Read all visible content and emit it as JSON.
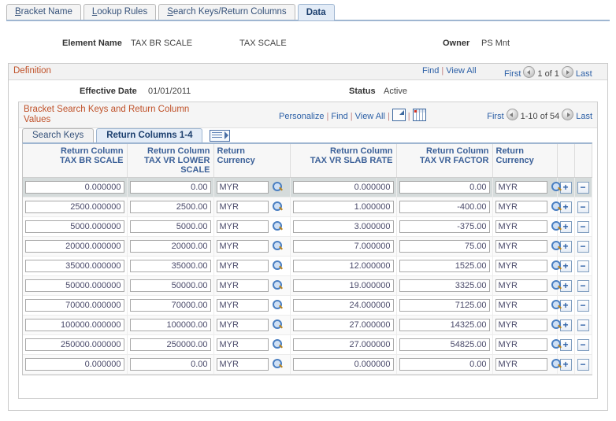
{
  "tabs": [
    {
      "label": "Bracket Name",
      "accel": "B",
      "active": false
    },
    {
      "label": "Lookup Rules",
      "accel": "L",
      "active": false
    },
    {
      "label": "Search Keys/Return Columns",
      "accel": "S",
      "active": false
    },
    {
      "label": "Data",
      "accel": "",
      "active": true
    }
  ],
  "header": {
    "element_name_label": "Element Name",
    "element_name_value": "TAX BR SCALE",
    "element_description": "TAX SCALE",
    "owner_label": "Owner",
    "owner_value": "PS Mnt"
  },
  "definition": {
    "title": "Definition",
    "find_label": "Find",
    "view_all_label": "View All",
    "first_label": "First",
    "position_label": "1 of 1",
    "last_label": "Last",
    "effective_date_label": "Effective Date",
    "effective_date_value": "01/01/2011",
    "status_label": "Status",
    "status_value": "Active"
  },
  "grid": {
    "title": "Bracket Search Keys and Return Column Values",
    "personalize_label": "Personalize",
    "find_label": "Find",
    "view_all_label": "View All",
    "newwindow_icon": "new-window-icon",
    "downloadgrid_icon": "download-grid-icon",
    "first_label": "First",
    "position_label": "1-10 of 54",
    "last_label": "Last",
    "subtabs": [
      {
        "label": "Search Keys",
        "accel": "S",
        "active": false
      },
      {
        "label": "Return Columns 1-4",
        "accel": "",
        "active": true
      }
    ],
    "expand_columns_icon": "expand-columns-icon",
    "columns": [
      {
        "line1": "Return Column",
        "line2": "TAX BR SCALE",
        "align": "right"
      },
      {
        "line1": "Return Column",
        "line2": "TAX VR LOWER SCALE",
        "align": "right"
      },
      {
        "line1": "Return",
        "line2": "Currency",
        "align": "left"
      },
      {
        "line1": "Return Column",
        "line2": "TAX VR SLAB RATE",
        "align": "right"
      },
      {
        "line1": "Return Column",
        "line2": "TAX VR FACTOR",
        "align": "right"
      },
      {
        "line1": "Return Currency",
        "line2": "",
        "align": "left"
      }
    ],
    "add_button_label": "+",
    "delete_button_label": "−",
    "search_icon": "lookup-search-icon",
    "rows": [
      {
        "selected": true,
        "tax_br_scale": "0.000000",
        "tax_vr_lower_scale": "0.00",
        "currency1": "MYR",
        "tax_vr_slab_rate": "0.000000",
        "tax_vr_factor": "0.00",
        "currency2": "MYR"
      },
      {
        "selected": false,
        "tax_br_scale": "2500.000000",
        "tax_vr_lower_scale": "2500.00",
        "currency1": "MYR",
        "tax_vr_slab_rate": "1.000000",
        "tax_vr_factor": "-400.00",
        "currency2": "MYR"
      },
      {
        "selected": false,
        "tax_br_scale": "5000.000000",
        "tax_vr_lower_scale": "5000.00",
        "currency1": "MYR",
        "tax_vr_slab_rate": "3.000000",
        "tax_vr_factor": "-375.00",
        "currency2": "MYR"
      },
      {
        "selected": false,
        "tax_br_scale": "20000.000000",
        "tax_vr_lower_scale": "20000.00",
        "currency1": "MYR",
        "tax_vr_slab_rate": "7.000000",
        "tax_vr_factor": "75.00",
        "currency2": "MYR"
      },
      {
        "selected": false,
        "tax_br_scale": "35000.000000",
        "tax_vr_lower_scale": "35000.00",
        "currency1": "MYR",
        "tax_vr_slab_rate": "12.000000",
        "tax_vr_factor": "1525.00",
        "currency2": "MYR"
      },
      {
        "selected": false,
        "tax_br_scale": "50000.000000",
        "tax_vr_lower_scale": "50000.00",
        "currency1": "MYR",
        "tax_vr_slab_rate": "19.000000",
        "tax_vr_factor": "3325.00",
        "currency2": "MYR"
      },
      {
        "selected": false,
        "tax_br_scale": "70000.000000",
        "tax_vr_lower_scale": "70000.00",
        "currency1": "MYR",
        "tax_vr_slab_rate": "24.000000",
        "tax_vr_factor": "7125.00",
        "currency2": "MYR"
      },
      {
        "selected": false,
        "tax_br_scale": "100000.000000",
        "tax_vr_lower_scale": "100000.00",
        "currency1": "MYR",
        "tax_vr_slab_rate": "27.000000",
        "tax_vr_factor": "14325.00",
        "currency2": "MYR"
      },
      {
        "selected": false,
        "tax_br_scale": "250000.000000",
        "tax_vr_lower_scale": "250000.00",
        "currency1": "MYR",
        "tax_vr_slab_rate": "27.000000",
        "tax_vr_factor": "54825.00",
        "currency2": "MYR"
      },
      {
        "selected": false,
        "tax_br_scale": "0.000000",
        "tax_vr_lower_scale": "0.00",
        "currency1": "MYR",
        "tax_vr_slab_rate": "0.000000",
        "tax_vr_factor": "0.00",
        "currency2": "MYR"
      }
    ]
  },
  "colors": {
    "group_label": "#c0522a",
    "link": "#2b5fa6",
    "column_header": "#3b6098",
    "tab_active_bg": "#e3ecf7",
    "selected_row_bg": "#d5dbdb"
  }
}
